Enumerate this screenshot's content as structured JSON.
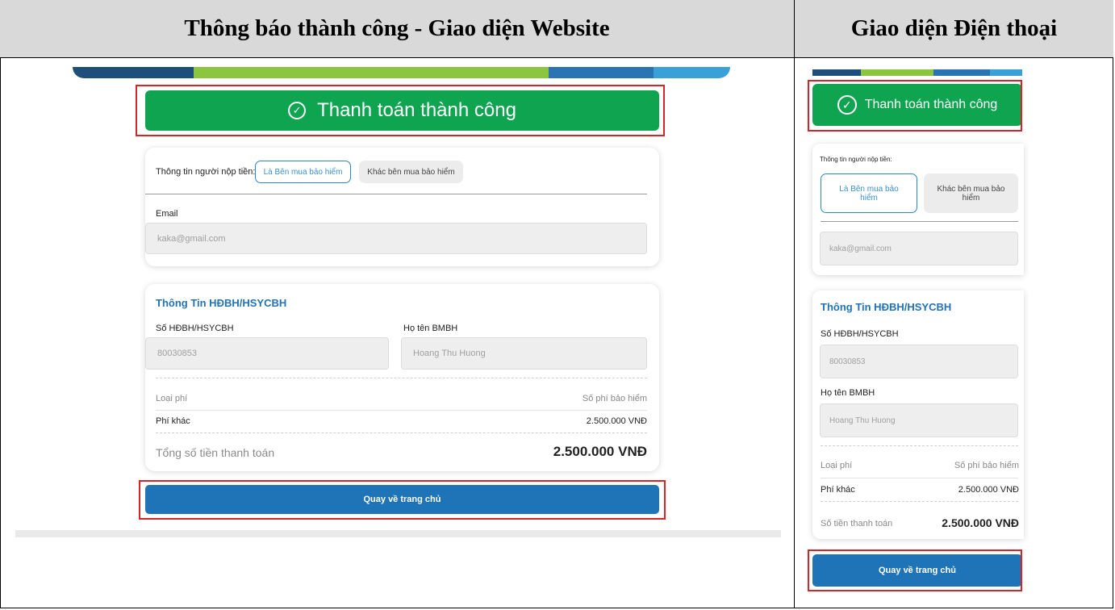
{
  "headers": {
    "website": "Thông báo thành công - Giao diện Website",
    "mobile": "Giao diện Điện thoại"
  },
  "success_message": "Thanh toán thành công",
  "payer": {
    "label_web": "Thông tin người nộp tiền:",
    "label_mobile": "Thông tin người nộp tiền:",
    "option_buyer": "Là Bên mua bảo hiểm",
    "option_other": "Khác bên mua bảo hiểm",
    "email_label": "Email",
    "email_value": "kaka@gmail.com"
  },
  "contract": {
    "title": "Thông Tin HĐBH/HSYCBH",
    "number_label": "Số HĐBH/HSYCBH",
    "number_value": "80030853",
    "name_label": "Họ tên BMBH",
    "name_value": "Hoang Thu Huong"
  },
  "fees": {
    "col_type": "Loại phí",
    "col_amount": "Số phí bảo hiểm",
    "rows": [
      {
        "type": "Phí khác",
        "amount": "2.500.000 VNĐ"
      }
    ],
    "total_label_web": "Tổng số tiền thanh toán",
    "total_label_mobile": "Số tiền thanh toán",
    "total_value": "2.500.000 VNĐ"
  },
  "home_button": "Quay về trang chủ",
  "colors": {
    "success_green": "#0fa44f",
    "primary_blue": "#1f74b8",
    "highlight_red": "#d6252a"
  }
}
